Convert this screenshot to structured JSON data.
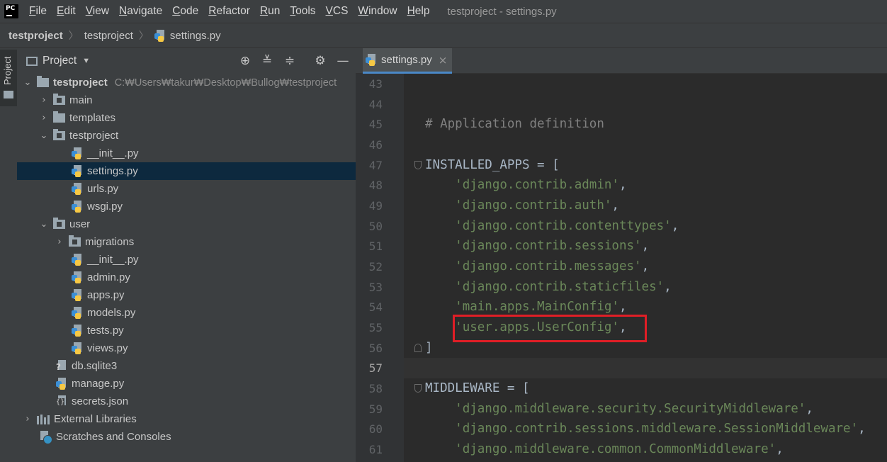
{
  "menu": {
    "items": [
      "File",
      "Edit",
      "View",
      "Navigate",
      "Code",
      "Refactor",
      "Run",
      "Tools",
      "VCS",
      "Window",
      "Help"
    ],
    "window_title": "testproject - settings.py"
  },
  "breadcrumb": {
    "items": [
      "testproject",
      "testproject",
      "settings.py"
    ]
  },
  "tool_strip": {
    "project_label": "Project"
  },
  "project_panel": {
    "title": "Project",
    "buttons": [
      "locate-icon",
      "expand-all-icon",
      "collapse-all-icon",
      "gear-icon",
      "minimize-icon"
    ],
    "tree": [
      {
        "label": "testproject",
        "path": "C:₩Users₩takur₩Desktop₩Bullog₩testproject",
        "kind": "folder",
        "expanded": true,
        "bold": true
      },
      {
        "label": "main",
        "kind": "module",
        "expanded": false
      },
      {
        "label": "templates",
        "kind": "folder",
        "expanded": false
      },
      {
        "label": "testproject",
        "kind": "module",
        "expanded": true
      },
      {
        "label": "__init__.py",
        "kind": "py"
      },
      {
        "label": "settings.py",
        "kind": "py",
        "selected": true
      },
      {
        "label": "urls.py",
        "kind": "py"
      },
      {
        "label": "wsgi.py",
        "kind": "py"
      },
      {
        "label": "user",
        "kind": "module",
        "expanded": true
      },
      {
        "label": "migrations",
        "kind": "module",
        "expanded": false
      },
      {
        "label": "__init__.py",
        "kind": "py"
      },
      {
        "label": "admin.py",
        "kind": "py"
      },
      {
        "label": "apps.py",
        "kind": "py"
      },
      {
        "label": "models.py",
        "kind": "py"
      },
      {
        "label": "tests.py",
        "kind": "py"
      },
      {
        "label": "views.py",
        "kind": "py"
      },
      {
        "label": "db.sqlite3",
        "kind": "db"
      },
      {
        "label": "manage.py",
        "kind": "py"
      },
      {
        "label": "secrets.json",
        "kind": "json"
      },
      {
        "label": "External Libraries",
        "kind": "lib",
        "expanded": false
      },
      {
        "label": "Scratches and Consoles",
        "kind": "scratch"
      }
    ]
  },
  "editor": {
    "tab": {
      "label": "settings.py",
      "close": "×"
    },
    "lines": [
      {
        "n": "43",
        "text": ""
      },
      {
        "n": "44",
        "text": ""
      },
      {
        "n": "45",
        "text": "# Application definition",
        "type": "comment"
      },
      {
        "n": "46",
        "text": ""
      },
      {
        "n": "47",
        "text": "INSTALLED_APPS = [",
        "fold": "start"
      },
      {
        "n": "48",
        "str": "'django.contrib.admin'",
        "tail": ","
      },
      {
        "n": "49",
        "str": "'django.contrib.auth'",
        "tail": ","
      },
      {
        "n": "50",
        "str": "'django.contrib.contenttypes'",
        "tail": ","
      },
      {
        "n": "51",
        "str": "'django.contrib.sessions'",
        "tail": ","
      },
      {
        "n": "52",
        "str": "'django.contrib.messages'",
        "tail": ","
      },
      {
        "n": "53",
        "str": "'django.contrib.staticfiles'",
        "tail": ","
      },
      {
        "n": "54",
        "str": "'main.apps.MainConfig'",
        "tail": ","
      },
      {
        "n": "55",
        "str": "'user.apps.UserConfig'",
        "tail": ",",
        "highlight": true
      },
      {
        "n": "56",
        "text": "]",
        "fold": "end"
      },
      {
        "n": "57",
        "text": "",
        "current": true
      },
      {
        "n": "58",
        "text": "MIDDLEWARE = [",
        "fold": "start"
      },
      {
        "n": "59",
        "str": "'django.middleware.security.SecurityMiddleware'",
        "tail": ","
      },
      {
        "n": "60",
        "str": "'django.contrib.sessions.middleware.SessionMiddleware'",
        "tail": ","
      },
      {
        "n": "61",
        "str": "'django.middleware.common.CommonMiddleware'",
        "tail": ","
      }
    ],
    "highlight_color": "#e01e26"
  },
  "colors": {
    "background": "#2b2b2b",
    "panel": "#3c3f41",
    "selection": "#0d293e",
    "string": "#6a8759",
    "comment": "#808080",
    "code": "#a9b7c6"
  }
}
